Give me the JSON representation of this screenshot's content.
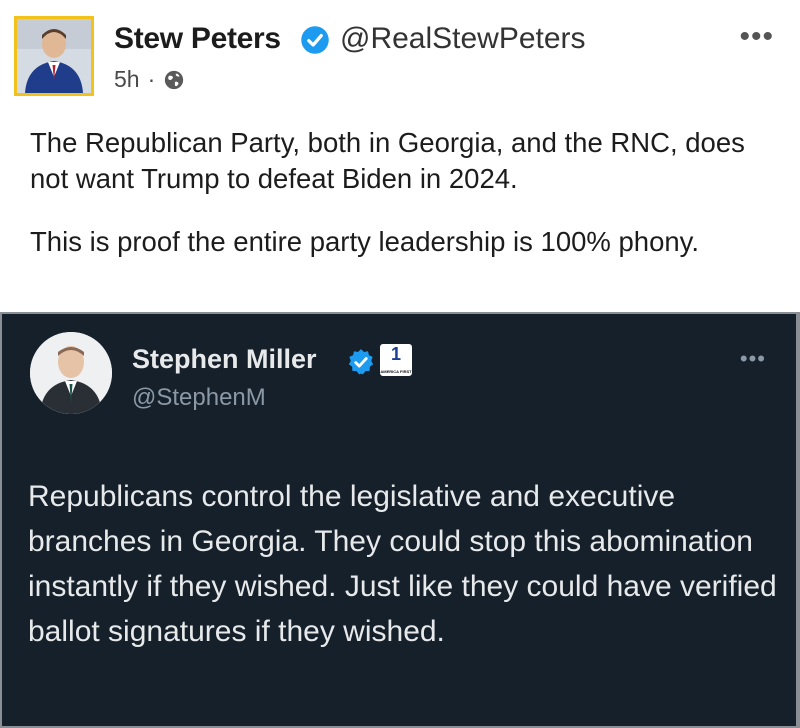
{
  "post": {
    "author_name": "Stew Peters",
    "handle": "@RealStewPeters",
    "time": "5h",
    "separator": "·",
    "more_label": "•••",
    "paragraphs": [
      "The Republican Party, both in Georgia, and the RNC, does not want Trump to defeat Biden in 2024.",
      "This is proof the entire party leadership is 100% phony."
    ]
  },
  "embedded_tweet": {
    "author_name": "Stephen Miller",
    "handle": "@StephenM",
    "more_label": "•••",
    "badge": {
      "number": "1",
      "label": "AMERICA FIRST"
    },
    "text": "Republicans control the legislative and executive branches in Georgia. They could stop this abomination instantly if they wished. Just like they could have verified ballot signatures if they wished."
  },
  "colors": {
    "verified_blue": "#1d9bf0",
    "dark_background": "#15202b",
    "avatar_border": "#f2c21b"
  },
  "icons": {
    "verified": "verified-badge-icon",
    "globe": "globe-icon",
    "more": "more-options-icon"
  }
}
